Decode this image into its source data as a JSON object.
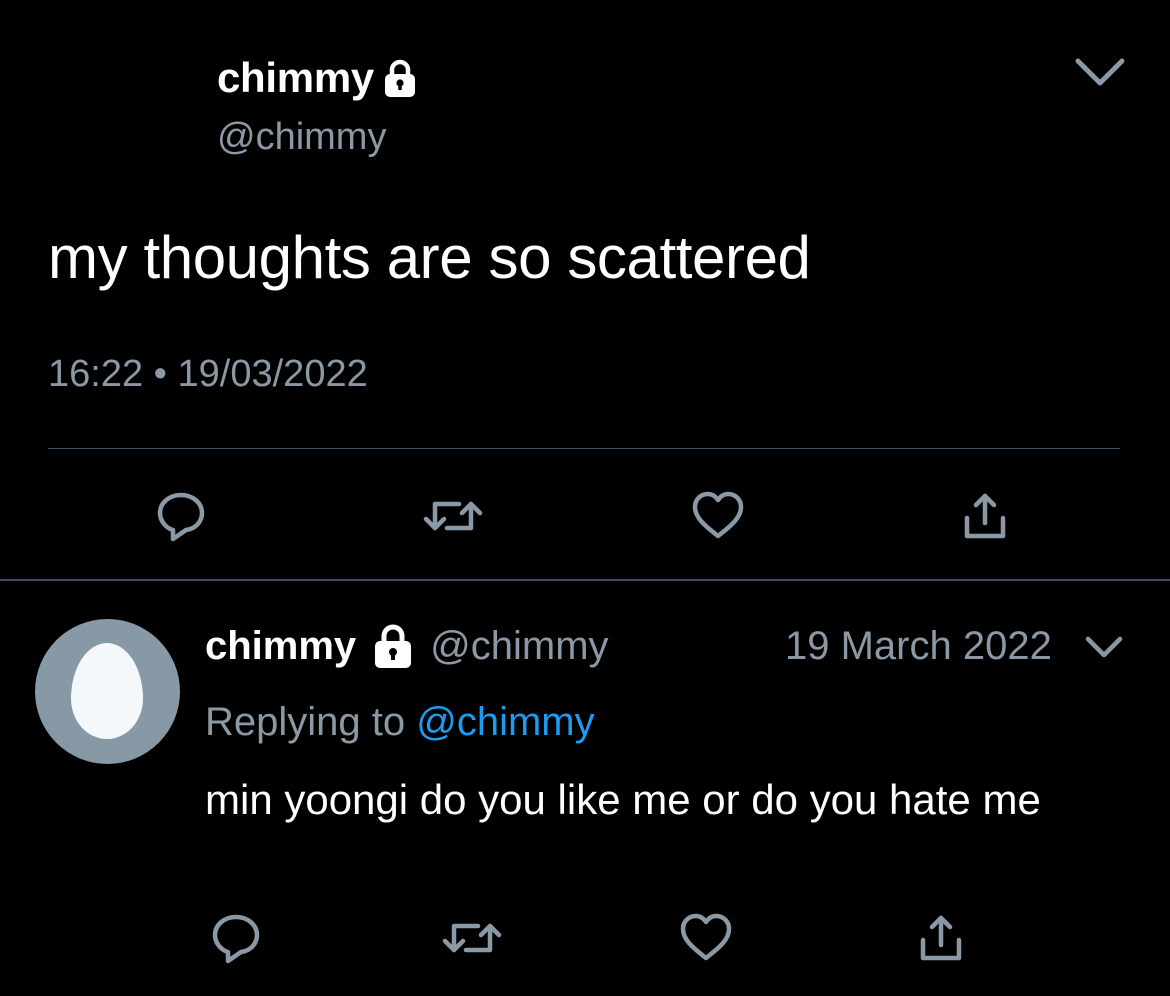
{
  "main_tweet": {
    "display_name": "chimmy",
    "handle": "@chimmy",
    "text": "my thoughts are so scattered",
    "time": "16:22",
    "separator": "•",
    "date": "19/03/2022",
    "icons": {
      "lock": "lock-icon",
      "menu": "chevron-down-icon",
      "reply": "reply-icon",
      "retweet": "retweet-icon",
      "like": "heart-icon",
      "share": "share-icon"
    }
  },
  "reply_tweet": {
    "display_name": "chimmy",
    "handle": "@chimmy",
    "date": "19 March 2022",
    "replying_label": "Replying to",
    "replying_handle": "@chimmy",
    "text": "min yoongi do you like me or do you hate me",
    "avatar": "default-egg-avatar"
  },
  "colors": {
    "background": "#000000",
    "text_primary": "#ffffff",
    "text_secondary": "#8b98a5",
    "link": "#1d9bf0",
    "divider": "#3d4f5e",
    "avatar_bg": "#8899a6"
  }
}
